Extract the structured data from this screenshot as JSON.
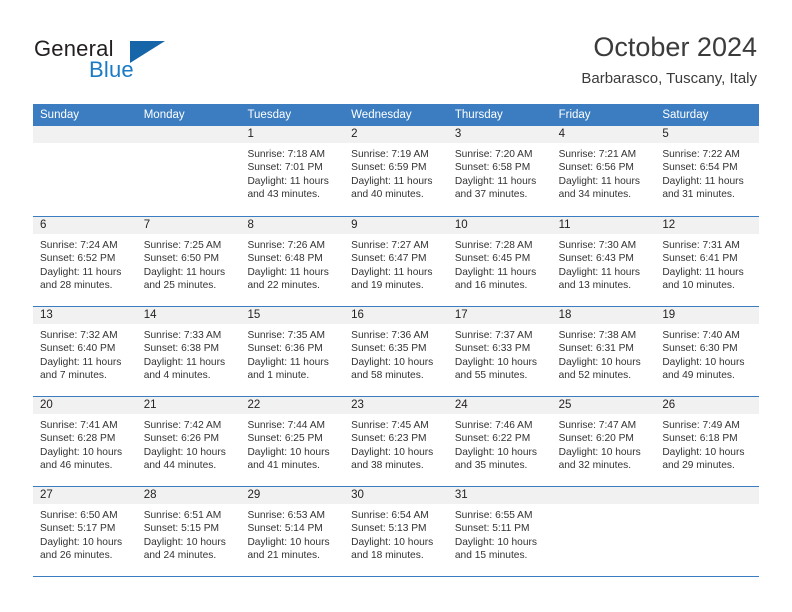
{
  "brand": {
    "name_part1": "General",
    "name_part2": "Blue",
    "triangle_color": "#1565a8",
    "accent_color": "#1a7bc4"
  },
  "header": {
    "title": "October 2024",
    "subtitle": "Barbarasco, Tuscany, Italy"
  },
  "theme": {
    "header_band": "#3b7dc0",
    "daynum_band": "#f1f1f1",
    "text": "#231f20"
  },
  "weekdays": [
    "Sunday",
    "Monday",
    "Tuesday",
    "Wednesday",
    "Thursday",
    "Friday",
    "Saturday"
  ],
  "weeks": [
    [
      {
        "day": "",
        "sunrise": "",
        "sunset": "",
        "daylight": ""
      },
      {
        "day": "",
        "sunrise": "",
        "sunset": "",
        "daylight": ""
      },
      {
        "day": "1",
        "sunrise": "Sunrise: 7:18 AM",
        "sunset": "Sunset: 7:01 PM",
        "daylight": "Daylight: 11 hours and 43 minutes."
      },
      {
        "day": "2",
        "sunrise": "Sunrise: 7:19 AM",
        "sunset": "Sunset: 6:59 PM",
        "daylight": "Daylight: 11 hours and 40 minutes."
      },
      {
        "day": "3",
        "sunrise": "Sunrise: 7:20 AM",
        "sunset": "Sunset: 6:58 PM",
        "daylight": "Daylight: 11 hours and 37 minutes."
      },
      {
        "day": "4",
        "sunrise": "Sunrise: 7:21 AM",
        "sunset": "Sunset: 6:56 PM",
        "daylight": "Daylight: 11 hours and 34 minutes."
      },
      {
        "day": "5",
        "sunrise": "Sunrise: 7:22 AM",
        "sunset": "Sunset: 6:54 PM",
        "daylight": "Daylight: 11 hours and 31 minutes."
      }
    ],
    [
      {
        "day": "6",
        "sunrise": "Sunrise: 7:24 AM",
        "sunset": "Sunset: 6:52 PM",
        "daylight": "Daylight: 11 hours and 28 minutes."
      },
      {
        "day": "7",
        "sunrise": "Sunrise: 7:25 AM",
        "sunset": "Sunset: 6:50 PM",
        "daylight": "Daylight: 11 hours and 25 minutes."
      },
      {
        "day": "8",
        "sunrise": "Sunrise: 7:26 AM",
        "sunset": "Sunset: 6:48 PM",
        "daylight": "Daylight: 11 hours and 22 minutes."
      },
      {
        "day": "9",
        "sunrise": "Sunrise: 7:27 AM",
        "sunset": "Sunset: 6:47 PM",
        "daylight": "Daylight: 11 hours and 19 minutes."
      },
      {
        "day": "10",
        "sunrise": "Sunrise: 7:28 AM",
        "sunset": "Sunset: 6:45 PM",
        "daylight": "Daylight: 11 hours and 16 minutes."
      },
      {
        "day": "11",
        "sunrise": "Sunrise: 7:30 AM",
        "sunset": "Sunset: 6:43 PM",
        "daylight": "Daylight: 11 hours and 13 minutes."
      },
      {
        "day": "12",
        "sunrise": "Sunrise: 7:31 AM",
        "sunset": "Sunset: 6:41 PM",
        "daylight": "Daylight: 11 hours and 10 minutes."
      }
    ],
    [
      {
        "day": "13",
        "sunrise": "Sunrise: 7:32 AM",
        "sunset": "Sunset: 6:40 PM",
        "daylight": "Daylight: 11 hours and 7 minutes."
      },
      {
        "day": "14",
        "sunrise": "Sunrise: 7:33 AM",
        "sunset": "Sunset: 6:38 PM",
        "daylight": "Daylight: 11 hours and 4 minutes."
      },
      {
        "day": "15",
        "sunrise": "Sunrise: 7:35 AM",
        "sunset": "Sunset: 6:36 PM",
        "daylight": "Daylight: 11 hours and 1 minute."
      },
      {
        "day": "16",
        "sunrise": "Sunrise: 7:36 AM",
        "sunset": "Sunset: 6:35 PM",
        "daylight": "Daylight: 10 hours and 58 minutes."
      },
      {
        "day": "17",
        "sunrise": "Sunrise: 7:37 AM",
        "sunset": "Sunset: 6:33 PM",
        "daylight": "Daylight: 10 hours and 55 minutes."
      },
      {
        "day": "18",
        "sunrise": "Sunrise: 7:38 AM",
        "sunset": "Sunset: 6:31 PM",
        "daylight": "Daylight: 10 hours and 52 minutes."
      },
      {
        "day": "19",
        "sunrise": "Sunrise: 7:40 AM",
        "sunset": "Sunset: 6:30 PM",
        "daylight": "Daylight: 10 hours and 49 minutes."
      }
    ],
    [
      {
        "day": "20",
        "sunrise": "Sunrise: 7:41 AM",
        "sunset": "Sunset: 6:28 PM",
        "daylight": "Daylight: 10 hours and 46 minutes."
      },
      {
        "day": "21",
        "sunrise": "Sunrise: 7:42 AM",
        "sunset": "Sunset: 6:26 PM",
        "daylight": "Daylight: 10 hours and 44 minutes."
      },
      {
        "day": "22",
        "sunrise": "Sunrise: 7:44 AM",
        "sunset": "Sunset: 6:25 PM",
        "daylight": "Daylight: 10 hours and 41 minutes."
      },
      {
        "day": "23",
        "sunrise": "Sunrise: 7:45 AM",
        "sunset": "Sunset: 6:23 PM",
        "daylight": "Daylight: 10 hours and 38 minutes."
      },
      {
        "day": "24",
        "sunrise": "Sunrise: 7:46 AM",
        "sunset": "Sunset: 6:22 PM",
        "daylight": "Daylight: 10 hours and 35 minutes."
      },
      {
        "day": "25",
        "sunrise": "Sunrise: 7:47 AM",
        "sunset": "Sunset: 6:20 PM",
        "daylight": "Daylight: 10 hours and 32 minutes."
      },
      {
        "day": "26",
        "sunrise": "Sunrise: 7:49 AM",
        "sunset": "Sunset: 6:18 PM",
        "daylight": "Daylight: 10 hours and 29 minutes."
      }
    ],
    [
      {
        "day": "27",
        "sunrise": "Sunrise: 6:50 AM",
        "sunset": "Sunset: 5:17 PM",
        "daylight": "Daylight: 10 hours and 26 minutes."
      },
      {
        "day": "28",
        "sunrise": "Sunrise: 6:51 AM",
        "sunset": "Sunset: 5:15 PM",
        "daylight": "Daylight: 10 hours and 24 minutes."
      },
      {
        "day": "29",
        "sunrise": "Sunrise: 6:53 AM",
        "sunset": "Sunset: 5:14 PM",
        "daylight": "Daylight: 10 hours and 21 minutes."
      },
      {
        "day": "30",
        "sunrise": "Sunrise: 6:54 AM",
        "sunset": "Sunset: 5:13 PM",
        "daylight": "Daylight: 10 hours and 18 minutes."
      },
      {
        "day": "31",
        "sunrise": "Sunrise: 6:55 AM",
        "sunset": "Sunset: 5:11 PM",
        "daylight": "Daylight: 10 hours and 15 minutes."
      },
      {
        "day": "",
        "sunrise": "",
        "sunset": "",
        "daylight": ""
      },
      {
        "day": "",
        "sunrise": "",
        "sunset": "",
        "daylight": ""
      }
    ]
  ]
}
